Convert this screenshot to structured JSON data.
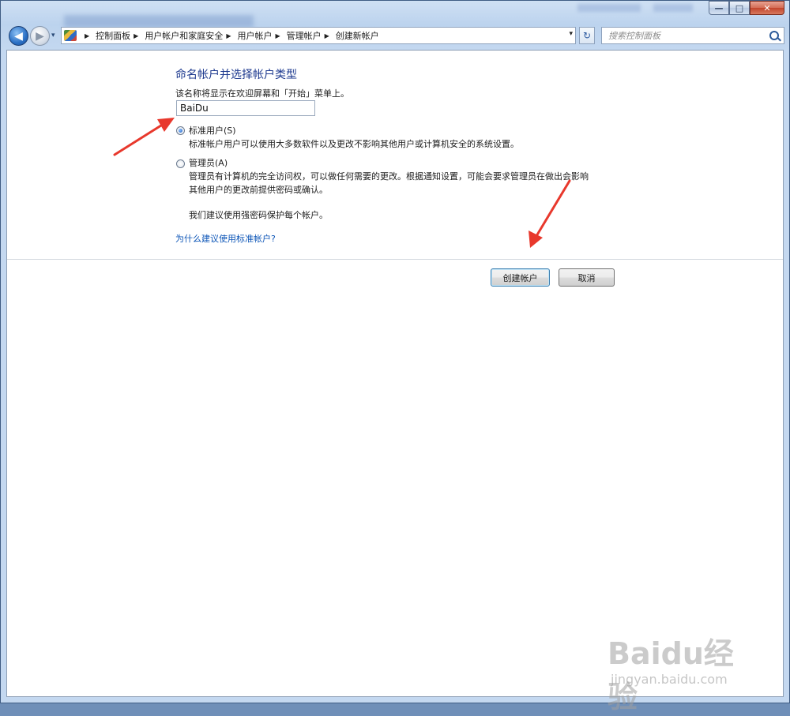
{
  "window": {
    "minimize_glyph": "—",
    "maximize_glyph": "□",
    "close_glyph": "✕"
  },
  "navigation": {
    "back_glyph": "◀",
    "forward_glyph": "▶",
    "history_glyph": "▾",
    "breadcrumbs": [
      "控制面板",
      "用户帐户和家庭安全",
      "用户帐户",
      "管理帐户",
      "创建新帐户"
    ],
    "address_dropdown_glyph": "▾",
    "refresh_glyph": "↻",
    "search_placeholder": "搜索控制面板"
  },
  "form": {
    "heading": "命名帐户并选择帐户类型",
    "prompt": "该名称将显示在欢迎屏幕和「开始」菜单上。",
    "name_value": "BaiDu",
    "options": [
      {
        "label": "标准用户(S)",
        "checked": true,
        "description": [
          "标准帐户用户可以使用大多数软件以及更改不影响其他用户或计算机安全的系统设置。"
        ]
      },
      {
        "label": "管理员(A)",
        "checked": false,
        "description": [
          "管理员有计算机的完全访问权，可以做任何需要的更改。根据通知设置，可能会要求管理员在做出会影响",
          "其他用户的更改前提供密码或确认。",
          "",
          "我们建议使用强密码保护每个帐户。"
        ]
      }
    ],
    "help_link": "为什么建议使用标准帐户?",
    "create_button": "创建帐户",
    "cancel_button": "取消"
  },
  "watermark": {
    "logo_text": "Baidu经验",
    "url": "jingyan.baidu.com"
  },
  "colors": {
    "heading": "#1e3a8f",
    "link": "#0c55b7",
    "annotation_arrow": "#e8382c"
  }
}
